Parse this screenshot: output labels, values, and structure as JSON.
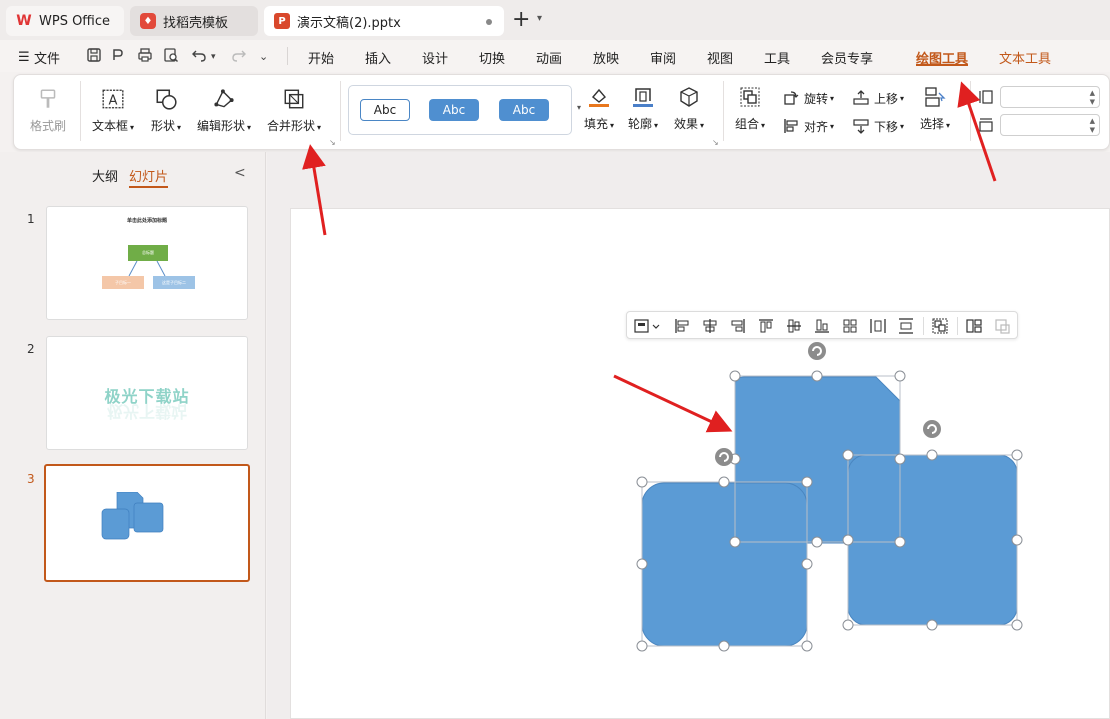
{
  "titlebar": {
    "tabs": [
      {
        "label": "WPS Office",
        "icon": "wps-logo-icon"
      },
      {
        "label": "找稻壳模板",
        "icon": "docer-icon"
      },
      {
        "label": "演示文稿(2).pptx",
        "icon": "presentation-file-icon"
      }
    ],
    "new_tab": "+",
    "new_tab_caret": "⌄"
  },
  "menubar": {
    "file": "文件",
    "items": [
      "开始",
      "插入",
      "设计",
      "切换",
      "动画",
      "放映",
      "审阅",
      "视图",
      "工具",
      "会员专享",
      "绘图工具",
      "文本工具"
    ],
    "active": "绘图工具",
    "ai_badge": "W"
  },
  "ribbon": {
    "format_painter": "格式刷",
    "text_box": "文本框",
    "shape": "形状",
    "edit_shape": "编辑形状",
    "merge_shape": "合并形状",
    "style_samples": [
      "Abc",
      "Abc",
      "Abc"
    ],
    "fill": "填充",
    "outline": "轮廓",
    "effect": "效果",
    "group": "组合",
    "rotate": "旋转",
    "align": "对齐",
    "bring_forward": "上移",
    "send_backward": "下移",
    "select": "选择",
    "height_value": "",
    "width_value": ""
  },
  "left_panel": {
    "tab_outline": "大纲",
    "tab_slides": "幻灯片",
    "collapse": "<",
    "slides": [
      {
        "number": "1",
        "title": "单击此处添加标题",
        "box_top": "总标题",
        "box_left": "子目标一",
        "box_right": "这是子目标二"
      },
      {
        "number": "2",
        "text": "极光下载站"
      },
      {
        "number": "3"
      }
    ],
    "active_slide": "3"
  },
  "colors": {
    "accent": "#c2581a",
    "shape_fill": "#5b9bd5",
    "style_fill": "#4f8fd0",
    "arrow": "#e02020",
    "green_box": "#70ad47",
    "peach_box": "#f4c7a8",
    "blue_box": "#9dc3e6"
  }
}
